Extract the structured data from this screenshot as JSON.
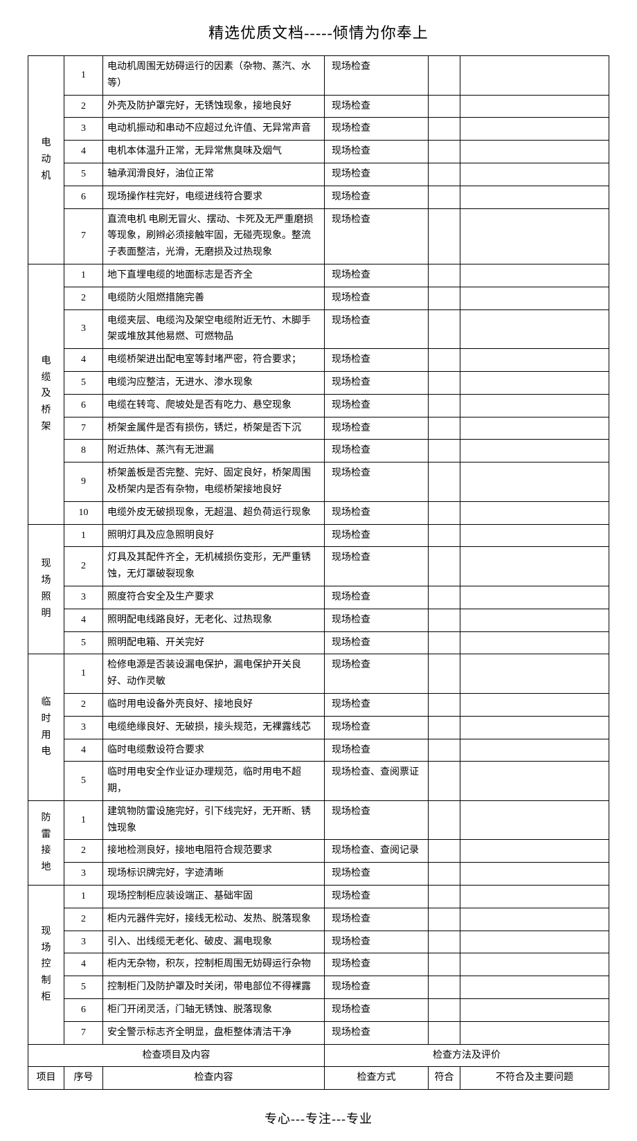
{
  "header": "精选优质文档-----倾情为你奉上",
  "footer": "专心---专注---专业",
  "bottomHeaders": {
    "span1": "检查项目及内容",
    "span2": "检查方法及评价",
    "c1": "项目",
    "c2": "序号",
    "c3": "检查内容",
    "c4": "检查方式",
    "c5": "符合",
    "c6": "不符合及主要问题"
  },
  "groups": [
    {
      "name": "电动机",
      "rows": [
        {
          "n": "1",
          "content": "电动机周围无妨碍运行的因素（杂物、蒸汽、水等）",
          "method": "现场检查"
        },
        {
          "n": "2",
          "content": "外壳及防护罩完好，无锈蚀现象，接地良好",
          "method": "现场检查"
        },
        {
          "n": "3",
          "content": "电动机振动和串动不应超过允许值、无异常声音",
          "method": "现场检查"
        },
        {
          "n": "4",
          "content": "电机本体温升正常，无异常焦臭味及烟气",
          "method": "现场检查"
        },
        {
          "n": "5",
          "content": "轴承润滑良好，油位正常",
          "method": "现场检查"
        },
        {
          "n": "6",
          "content": "现场操作柱完好，电缆进线符合要求",
          "method": "现场检查"
        },
        {
          "n": "7",
          "content": "直流电机 电刷无冒火、摆动、卡死及无严重磨损等现象，刷辫必须接触牢固，无碰壳现象。整流子表面整洁，光滑，无磨损及过热现象",
          "method": "现场检查"
        }
      ]
    },
    {
      "name": "电缆及桥架",
      "rows": [
        {
          "n": "1",
          "content": "地下直埋电缆的地面标志是否齐全",
          "method": "现场检查"
        },
        {
          "n": "2",
          "content": "电缆防火阻燃措施完善",
          "method": "现场检查"
        },
        {
          "n": "3",
          "content": "电缆夹层、电缆沟及架空电缆附近无竹、木脚手架或堆放其他易燃、可燃物品",
          "method": "现场检查"
        },
        {
          "n": "4",
          "content": "电缆桥架进出配电室等封堵严密，符合要求；",
          "method": "现场检查"
        },
        {
          "n": "5",
          "content": "电缆沟应整洁，无进水、渗水现象",
          "method": "现场检查"
        },
        {
          "n": "6",
          "content": "电缆在转弯、爬坡处是否有吃力、悬空现象",
          "method": "现场检查"
        },
        {
          "n": "7",
          "content": "桥架金属件是否有损伤，锈烂，桥架是否下沉",
          "method": "现场检查"
        },
        {
          "n": "8",
          "content": "附近热体、蒸汽有无泄漏",
          "method": "现场检查"
        },
        {
          "n": "9",
          "content": "桥架盖板是否完整、完好、固定良好，桥架周围及桥架内是否有杂物，电缆桥架接地良好",
          "method": "现场检查"
        },
        {
          "n": "10",
          "content": "电缆外皮无破损现象，无超温、超负荷运行现象",
          "method": "现场检查"
        }
      ]
    },
    {
      "name": "现场照明",
      "rows": [
        {
          "n": "1",
          "content": "照明灯具及应急照明良好",
          "method": "现场检查"
        },
        {
          "n": "2",
          "content": "灯具及其配件齐全，无机械损伤变形，无严重锈蚀，无灯罩破裂现象",
          "method": "现场检查"
        },
        {
          "n": "3",
          "content": "照度符合安全及生产要求",
          "method": "现场检查"
        },
        {
          "n": "4",
          "content": "照明配电线路良好，无老化、过热现象",
          "method": "现场检查"
        },
        {
          "n": "5",
          "content": "照明配电箱、开关完好",
          "method": "现场检查"
        }
      ]
    },
    {
      "name": "临时用电",
      "rows": [
        {
          "n": "1",
          "content": "检修电源是否装设漏电保护，漏电保护开关良好、动作灵敏",
          "method": "现场检查"
        },
        {
          "n": "2",
          "content": "临时用电设备外壳良好、接地良好",
          "method": "现场检查"
        },
        {
          "n": "3",
          "content": "电缆绝缘良好、无破损，接头规范，无裸露线芯",
          "method": "现场检查"
        },
        {
          "n": "4",
          "content": "临时电缆敷设符合要求",
          "method": "现场检查"
        },
        {
          "n": "5",
          "content": "临时用电安全作业证办理规范，临时用电不超期，",
          "method": "现场检查、查阅票证"
        }
      ]
    },
    {
      "name": "防雷接地",
      "rows": [
        {
          "n": "1",
          "content": "建筑物防雷设施完好，引下线完好，无开断、锈蚀现象",
          "method": "现场检查"
        },
        {
          "n": "2",
          "content": "接地检测良好，接地电阻符合规范要求",
          "method": "现场检查、查阅记录"
        },
        {
          "n": "3",
          "content": "现场标识牌完好，字迹清晰",
          "method": "现场检查"
        }
      ]
    },
    {
      "name": "现场控制柜",
      "rows": [
        {
          "n": "1",
          "content": "现场控制柜应装设端正、基础牢固",
          "method": "现场检查"
        },
        {
          "n": "2",
          "content": "柜内元器件完好，接线无松动、发热、脱落现象",
          "method": "现场检查"
        },
        {
          "n": "3",
          "content": "引入、出线缆无老化、破皮、漏电现象",
          "method": "现场检查"
        },
        {
          "n": "4",
          "content": "柜内无杂物，积灰，控制柜周围无妨碍运行杂物",
          "method": "现场检查"
        },
        {
          "n": "5",
          "content": "控制柜门及防护罩及时关闭，带电部位不得裸露",
          "method": "现场检查"
        },
        {
          "n": "6",
          "content": "柜门开闭灵活，门轴无锈蚀、脱落现象",
          "method": "现场检查"
        },
        {
          "n": "7",
          "content": "安全警示标志齐全明显，盘柜整体清洁干净",
          "method": "现场检查"
        }
      ]
    }
  ]
}
